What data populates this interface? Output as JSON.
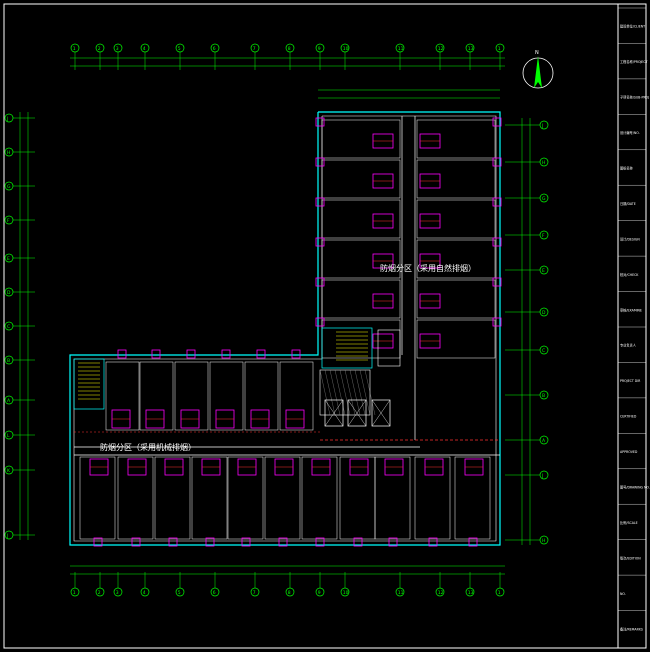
{
  "drawing": {
    "zone_label_right": "防烟分区（采用自然排烟）",
    "zone_label_left": "防烟分区（采用机械排烟）",
    "north_label": "N",
    "col_axes_top": [
      "1",
      "2",
      "3",
      "4",
      "5",
      "6",
      "7",
      "8",
      "9",
      "10",
      "11",
      "12",
      "13"
    ],
    "row_axes_left": [
      "J",
      "H",
      "G",
      "F",
      "E",
      "D",
      "C",
      "B",
      "A",
      "L",
      "K"
    ],
    "row_axes_right": [
      "J",
      "H",
      "G",
      "F",
      "E",
      "D",
      "C",
      "B",
      "A"
    ]
  },
  "title_block": {
    "rows": [
      "建设单位/CLIENT",
      "工程名称/PROJECT",
      "子项名称/SUB-PROJ",
      "设计编号/NO.",
      "图纸名称",
      "日期/DATE",
      "设计/DESIGN",
      "校对/CHECK",
      "审核/EXAMINE",
      "专业负责人",
      "PROJECT DIR",
      "CERTIFIED",
      "APPROVED",
      "图号/DRAWING NO.",
      "比例/SCALE",
      "版次/EDITION",
      "NO.",
      "备注/REMARKS"
    ]
  },
  "colors": {
    "wall": "#ffffff",
    "grid": "#00ff00",
    "cyan": "#00ffff",
    "magenta": "#ff00ff",
    "red": "#ff3030",
    "yellow": "#ffff00",
    "frame": "#ffffff"
  }
}
